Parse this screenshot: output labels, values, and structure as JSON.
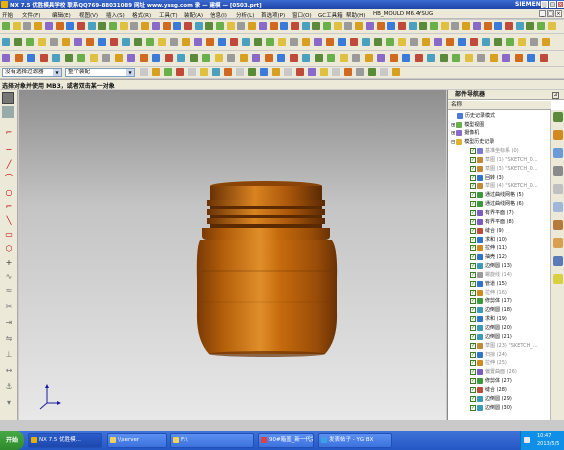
{
  "window": {
    "title": "NX 7.5 优胜模具学校 联系QQ769-88031089 网址 www.yssg.com 录 — 建模 — [0503.prt]",
    "brand": "SIEMENS",
    "controls": [
      "_",
      "□",
      "×"
    ]
  },
  "menu": {
    "items": [
      "开始",
      "文件(F)",
      "编辑(E)",
      "视图(V)",
      "插入(S)",
      "格式(R)",
      "工具(T)",
      "装配(A)",
      "信息(I)",
      "分析(L)",
      "首选项(P)",
      "窗口(O)",
      "GC工具箱",
      "帮助(H)",
      "HB_MOULD M6.4",
      "YSUG"
    ]
  },
  "filterbar": {
    "type_filter": "没有选择过滤器",
    "scope": "整个装配"
  },
  "status": {
    "prompt": "选择对象并使用 MB3，或者双击某一对象"
  },
  "navigator": {
    "title": "部件导航器",
    "column_header": "名称",
    "top_items": [
      {
        "label": "历史记录模式",
        "icon": "history-icon"
      },
      {
        "label": "模型视图",
        "icon": "model-view-icon"
      },
      {
        "label": "摄像机",
        "icon": "camera-icon"
      },
      {
        "label": "模型历史记录",
        "icon": "folder-icon"
      }
    ],
    "features": [
      {
        "label": "基准坐标系 (0)",
        "grey": true,
        "color": "#7b7bd6"
      },
      {
        "label": "草图 (1) \"SKETCH_0...",
        "grey": true,
        "color": "#c08a3a"
      },
      {
        "label": "草图 (3) \"SKETCH_0...",
        "grey": true,
        "color": "#c08a3a"
      },
      {
        "label": "回转 (3)",
        "grey": false,
        "color": "#2f74c8"
      },
      {
        "label": "草图 (4) \"SKETCH_0...",
        "grey": true,
        "color": "#c08a3a"
      },
      {
        "label": "通过曲线网格 (5)",
        "grey": false,
        "color": "#3a9a3a"
      },
      {
        "label": "通过曲线网格 (6)",
        "grey": false,
        "color": "#3a9a3a"
      },
      {
        "label": "有界平面 (7)",
        "grey": false,
        "color": "#7a5cc0"
      },
      {
        "label": "有界平面 (8)",
        "grey": false,
        "color": "#7a5cc0"
      },
      {
        "label": "缝合 (9)",
        "grey": false,
        "color": "#c04a3a"
      },
      {
        "label": "求和 (10)",
        "grey": false,
        "color": "#2f74c8"
      },
      {
        "label": "拉伸 (11)",
        "grey": false,
        "color": "#d08a20"
      },
      {
        "label": "抽壳 (12)",
        "grey": false,
        "color": "#2f74c8"
      },
      {
        "label": "边倒圆 (13)",
        "grey": false,
        "color": "#3a9ab8"
      },
      {
        "label": "螺旋线 (14)",
        "grey": true,
        "color": "#9a9a9a"
      },
      {
        "label": "管道 (15)",
        "grey": false,
        "color": "#2f74c8"
      },
      {
        "label": "拉伸 (16)",
        "grey": true,
        "color": "#d08a20"
      },
      {
        "label": "修剪体 (17)",
        "grey": false,
        "color": "#3a9a3a"
      },
      {
        "label": "边倒圆 (18)",
        "grey": false,
        "color": "#3a9ab8"
      },
      {
        "label": "求和 (19)",
        "grey": false,
        "color": "#2f74c8"
      },
      {
        "label": "边倒圆 (20)",
        "grey": false,
        "color": "#3a9ab8"
      },
      {
        "label": "边倒圆 (21)",
        "grey": false,
        "color": "#3a9ab8"
      },
      {
        "label": "草图 (23) \"SKETCH_...",
        "grey": true,
        "color": "#c08a3a"
      },
      {
        "label": "扫掠 (24)",
        "grey": true,
        "color": "#2f74c8"
      },
      {
        "label": "拉伸 (25)",
        "grey": true,
        "color": "#d08a20"
      },
      {
        "label": "偏置曲面 (26)",
        "grey": true,
        "color": "#7a5cc0"
      },
      {
        "label": "修剪体 (27)",
        "grey": false,
        "color": "#3a9a3a"
      },
      {
        "label": "缝合 (28)",
        "grey": false,
        "color": "#c04a3a"
      },
      {
        "label": "边倒圆 (29)",
        "grey": false,
        "color": "#3a9ab8"
      },
      {
        "label": "边倒圆 (30)",
        "grey": false,
        "color": "#3a9ab8"
      }
    ]
  },
  "taskbar": {
    "start": "开始",
    "tasks": [
      {
        "label": "NX 7.5 优胜模...",
        "active": true,
        "color": "#e8b000"
      },
      {
        "label": "\\\\server",
        "active": false,
        "color": "#f0d060"
      },
      {
        "label": "F:\\",
        "active": false,
        "color": "#f0d060"
      },
      {
        "label": "90#箱盖_新一代完",
        "active": false,
        "color": "#e04040"
      },
      {
        "label": "发表帖子 - YG BX",
        "active": false,
        "color": "#3aa0e8"
      }
    ],
    "time": "10:47",
    "date": "2013/5/5"
  },
  "colors": {
    "model_orange": "#c56a0c",
    "model_dark": "#7a3a05",
    "model_light": "#f0a540"
  }
}
